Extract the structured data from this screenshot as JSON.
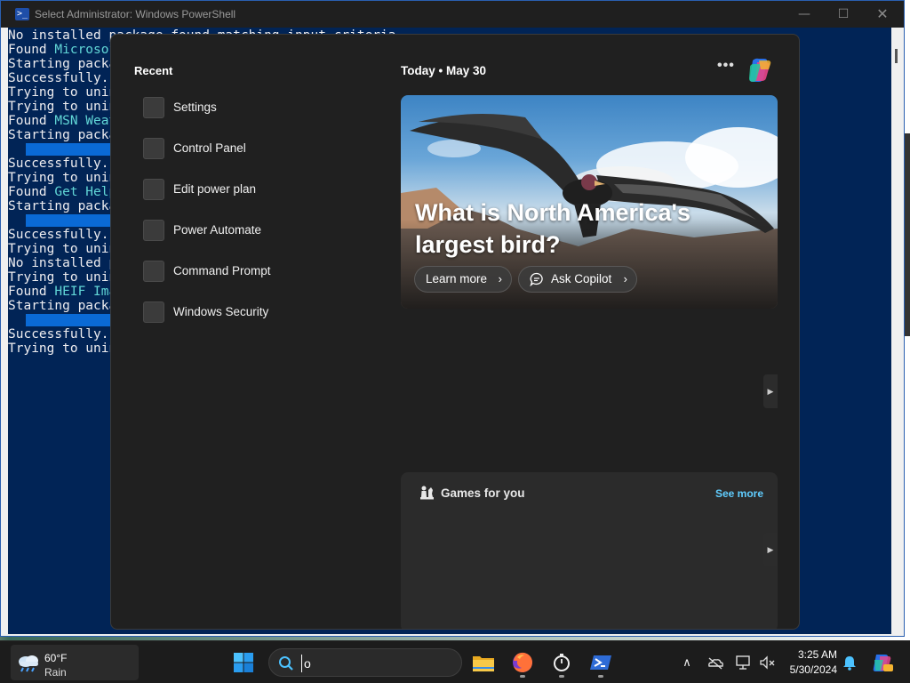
{
  "window": {
    "title": "Select Administrator: Windows PowerShell",
    "minimize_glyph": "—",
    "maximize_glyph": "☐",
    "close_glyph": "✕"
  },
  "console": {
    "lines": [
      {
        "text": "No installed package found matching input criteria."
      },
      {
        "prefix": "Found ",
        "highlight": "Microsoft..."
      },
      {
        "text": "Starting package..."
      },
      {
        "text": "Successfully..."
      },
      {
        "text": "Trying to uninstall..."
      },
      {
        "text": "Trying to uninstall..."
      },
      {
        "prefix": "Found ",
        "highlight": "MSN Weather..."
      },
      {
        "text": "Starting package..."
      },
      {
        "text": ""
      },
      {
        "text": "Successfully..."
      },
      {
        "text": "Trying to uninstall..."
      },
      {
        "prefix": "Found ",
        "highlight": "Get Help..."
      },
      {
        "text": "Starting package..."
      },
      {
        "text": ""
      },
      {
        "text": "Successfully..."
      },
      {
        "text": "Trying to uninstall..."
      },
      {
        "text": "No installed package..."
      },
      {
        "text": "Trying to uninstall..."
      },
      {
        "prefix": "Found ",
        "highlight": "HEIF Image..."
      },
      {
        "text": "Starting package..."
      },
      {
        "text": ""
      },
      {
        "text": "Successfully..."
      },
      {
        "text": "Trying to uninstall..."
      }
    ]
  },
  "flyout": {
    "recent_heading": "Recent",
    "recent_items": [
      {
        "label": "Settings"
      },
      {
        "label": "Control Panel"
      },
      {
        "label": "Edit power plan"
      },
      {
        "label": "Power Automate"
      },
      {
        "label": "Command Prompt"
      },
      {
        "label": "Windows Security"
      }
    ],
    "today_heading": "Today  •  May 30",
    "more_glyph": "•••",
    "hero": {
      "title": "What is North America's largest bird?",
      "learn_more": "Learn more",
      "ask_copilot": "Ask Copilot",
      "chevron": "›"
    },
    "side_arrow": "▶",
    "games": {
      "heading": "Games for you",
      "see_more": "See more"
    }
  },
  "taskbar": {
    "weather_temp": "60°F",
    "weather_condition": "Rain",
    "search_value": "o",
    "clock_time": "3:25 AM",
    "clock_date": "5/30/2024",
    "tray_chevron": "∧",
    "apps": [
      {
        "name": "file-explorer"
      },
      {
        "name": "firefox"
      },
      {
        "name": "clock"
      },
      {
        "name": "powershell"
      }
    ]
  }
}
